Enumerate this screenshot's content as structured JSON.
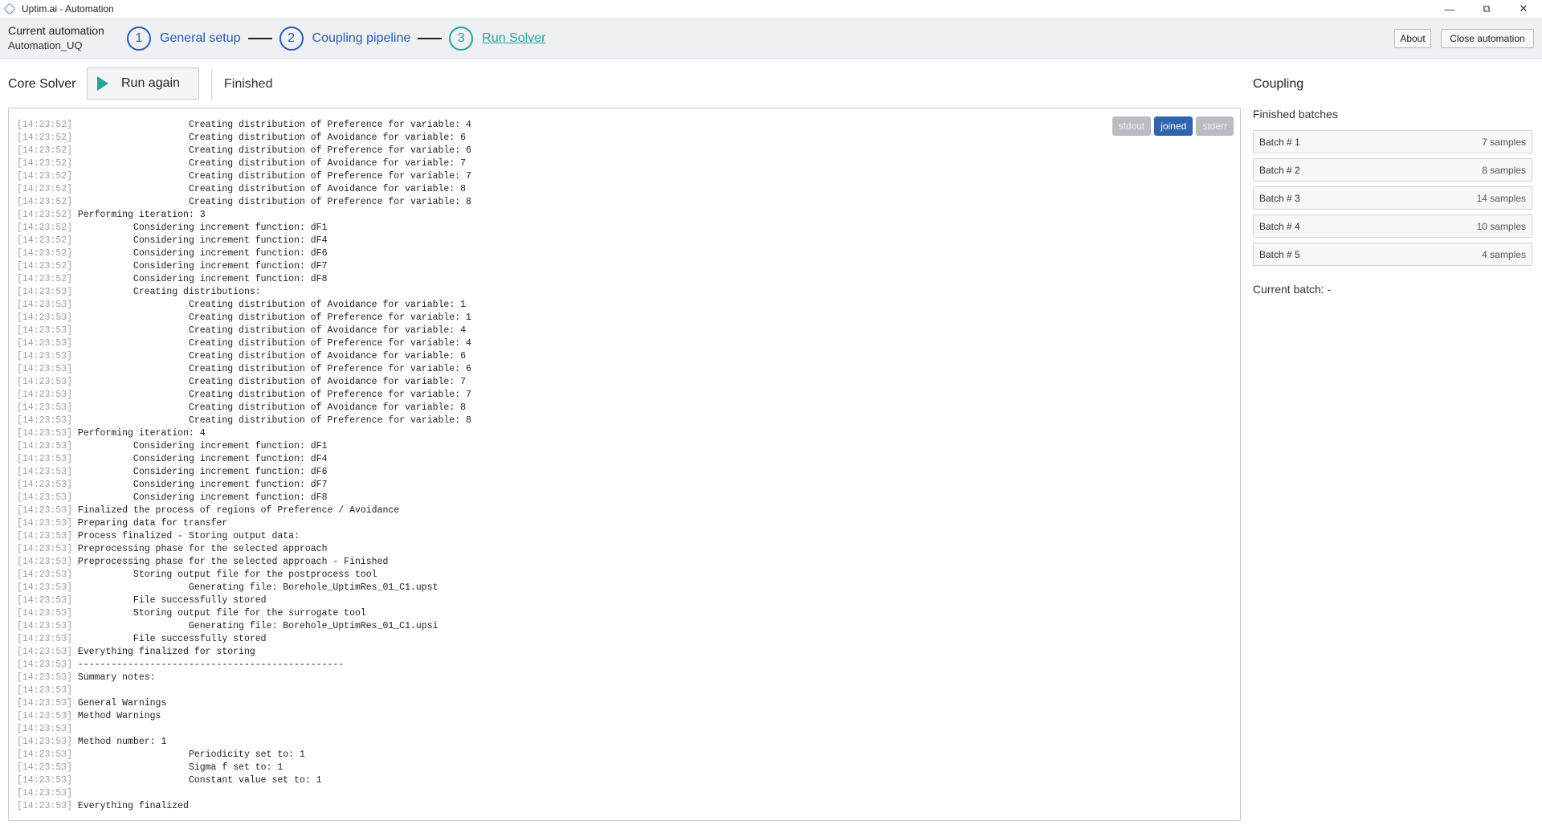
{
  "window": {
    "title": "Uptim.ai - Automation",
    "controls": [
      "minimize-icon",
      "restore-icon",
      "close-icon"
    ]
  },
  "header": {
    "current_automation_label": "Current automation",
    "current_automation_value": "Automation_UQ",
    "steps": [
      {
        "number": "1",
        "label": "General setup"
      },
      {
        "number": "2",
        "label": "Coupling pipeline"
      },
      {
        "number": "3",
        "label": "Run Solver"
      }
    ],
    "about_label": "About",
    "close_label": "Close automation"
  },
  "toolbar": {
    "section_title": "Core Solver",
    "run_label": "Run again",
    "status": "Finished"
  },
  "console": {
    "tabs": [
      {
        "label": "stdout",
        "active": false
      },
      {
        "label": "joined",
        "active": true
      },
      {
        "label": "stderr",
        "active": false
      }
    ],
    "lines": [
      {
        "ts": "[14:23:52]",
        "msg": "                    Creating distribution of Preference for variable: 4"
      },
      {
        "ts": "[14:23:52]",
        "msg": "                    Creating distribution of Avoidance for variable: 6"
      },
      {
        "ts": "[14:23:52]",
        "msg": "                    Creating distribution of Preference for variable: 6"
      },
      {
        "ts": "[14:23:52]",
        "msg": "                    Creating distribution of Avoidance for variable: 7"
      },
      {
        "ts": "[14:23:52]",
        "msg": "                    Creating distribution of Preference for variable: 7"
      },
      {
        "ts": "[14:23:52]",
        "msg": "                    Creating distribution of Avoidance for variable: 8"
      },
      {
        "ts": "[14:23:52]",
        "msg": "                    Creating distribution of Preference for variable: 8"
      },
      {
        "ts": "[14:23:52]",
        "msg": "Performing iteration: 3"
      },
      {
        "ts": "[14:23:52]",
        "msg": "          Considering increment function: dF1"
      },
      {
        "ts": "[14:23:52]",
        "msg": "          Considering increment function: dF4"
      },
      {
        "ts": "[14:23:52]",
        "msg": "          Considering increment function: dF6"
      },
      {
        "ts": "[14:23:52]",
        "msg": "          Considering increment function: dF7"
      },
      {
        "ts": "[14:23:52]",
        "msg": "          Considering increment function: dF8"
      },
      {
        "ts": "[14:23:53]",
        "msg": "          Creating distributions:"
      },
      {
        "ts": "[14:23:53]",
        "msg": "                    Creating distribution of Avoidance for variable: 1"
      },
      {
        "ts": "[14:23:53]",
        "msg": "                    Creating distribution of Preference for variable: 1"
      },
      {
        "ts": "[14:23:53]",
        "msg": "                    Creating distribution of Avoidance for variable: 4"
      },
      {
        "ts": "[14:23:53]",
        "msg": "                    Creating distribution of Preference for variable: 4"
      },
      {
        "ts": "[14:23:53]",
        "msg": "                    Creating distribution of Avoidance for variable: 6"
      },
      {
        "ts": "[14:23:53]",
        "msg": "                    Creating distribution of Preference for variable: 6"
      },
      {
        "ts": "[14:23:53]",
        "msg": "                    Creating distribution of Avoidance for variable: 7"
      },
      {
        "ts": "[14:23:53]",
        "msg": "                    Creating distribution of Preference for variable: 7"
      },
      {
        "ts": "[14:23:53]",
        "msg": "                    Creating distribution of Avoidance for variable: 8"
      },
      {
        "ts": "[14:23:53]",
        "msg": "                    Creating distribution of Preference for variable: 8"
      },
      {
        "ts": "[14:23:53]",
        "msg": "Performing iteration: 4"
      },
      {
        "ts": "[14:23:53]",
        "msg": "          Considering increment function: dF1"
      },
      {
        "ts": "[14:23:53]",
        "msg": "          Considering increment function: dF4"
      },
      {
        "ts": "[14:23:53]",
        "msg": "          Considering increment function: dF6"
      },
      {
        "ts": "[14:23:53]",
        "msg": "          Considering increment function: dF7"
      },
      {
        "ts": "[14:23:53]",
        "msg": "          Considering increment function: dF8"
      },
      {
        "ts": "[14:23:53]",
        "msg": "Finalized the process of regions of Preference / Avoidance"
      },
      {
        "ts": "[14:23:53]",
        "msg": "Preparing data for transfer"
      },
      {
        "ts": "[14:23:53]",
        "msg": "Process finalized - Storing output data:"
      },
      {
        "ts": "[14:23:53]",
        "msg": "Preprocessing phase for the selected approach"
      },
      {
        "ts": "[14:23:53]",
        "msg": "Preprocessing phase for the selected approach - Finished"
      },
      {
        "ts": "[14:23:53]",
        "msg": "          Storing output file for the postprocess tool"
      },
      {
        "ts": "[14:23:53]",
        "msg": "                    Generating file: Borehole_UptimRes_01_C1.upst"
      },
      {
        "ts": "[14:23:53]",
        "msg": "          File successfully stored"
      },
      {
        "ts": "[14:23:53]",
        "msg": "          Storing output file for the surrogate tool"
      },
      {
        "ts": "[14:23:53]",
        "msg": "                    Generating file: Borehole_UptimRes_01_C1.upsi"
      },
      {
        "ts": "[14:23:53]",
        "msg": "          File successfully stored"
      },
      {
        "ts": "[14:23:53]",
        "msg": "Everything finalized for storing"
      },
      {
        "ts": "[14:23:53]",
        "msg": "------------------------------------------------"
      },
      {
        "ts": "[14:23:53]",
        "msg": "Summary notes:"
      },
      {
        "ts": "[14:23:53]",
        "msg": ""
      },
      {
        "ts": "[14:23:53]",
        "msg": "General Warnings"
      },
      {
        "ts": "[14:23:53]",
        "msg": "Method Warnings"
      },
      {
        "ts": "[14:23:53]",
        "msg": ""
      },
      {
        "ts": "[14:23:53]",
        "msg": "Method number: 1"
      },
      {
        "ts": "[14:23:53]",
        "msg": "                    Periodicity set to: 1"
      },
      {
        "ts": "[14:23:53]",
        "msg": "                    Sigma f set to: 1"
      },
      {
        "ts": "[14:23:53]",
        "msg": "                    Constant value set to: 1"
      },
      {
        "ts": "[14:23:53]",
        "msg": ""
      },
      {
        "ts": "[14:23:53]",
        "msg": "Everything finalized"
      }
    ]
  },
  "coupling": {
    "title": "Coupling",
    "finished_label": "Finished batches",
    "batches": [
      {
        "name": "Batch # 1",
        "count": "7 samples"
      },
      {
        "name": "Batch # 2",
        "count": "8 samples"
      },
      {
        "name": "Batch # 3",
        "count": "14 samples"
      },
      {
        "name": "Batch # 4",
        "count": "10 samples"
      },
      {
        "name": "Batch # 5",
        "count": "4 samples"
      }
    ],
    "current_batch": "Current batch: -"
  },
  "colors": {
    "primary": "#2b5ca8",
    "accent": "#25a59b",
    "active_tab": "#2f64b0"
  }
}
